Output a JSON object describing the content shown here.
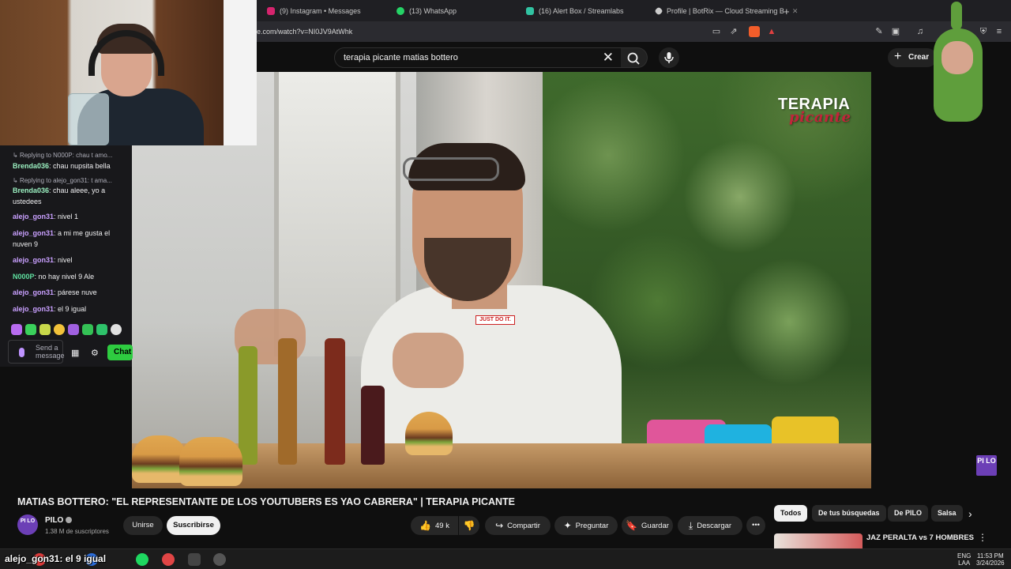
{
  "browser": {
    "tabs": [
      {
        "label": "(9) Instagram • Messages",
        "color": "#d6246e"
      },
      {
        "label": "(13) WhatsApp",
        "color": "#25d366"
      },
      {
        "label": "(16) Alert Box / Streamlabs",
        "color": "#31c3a2"
      },
      {
        "label": "Profile | BotRix — Cloud Streaming B",
        "color": "#cccccc"
      }
    ],
    "url": "e.com/watch?v=NI0JV9AtWhk"
  },
  "youtube": {
    "search_query": "terapia picante matias bottero",
    "create_label": "Crear",
    "watermark_top": "TERAPIA",
    "watermark_bottom": "picante",
    "channel_logo_text": "PI LO"
  },
  "video": {
    "title": "MATIAS BOTTERO: \"EL REPRESENTANTE DE LOS YOUTUBERS ES YAO CABRERA\" | TERAPIA PICANTE",
    "channel_name": "PILO",
    "subscribers": "1.38 M de suscriptores",
    "join_label": "Unirse",
    "subscribe_label": "Suscribirse",
    "likes": "49 k",
    "share_label": "Compartir",
    "ask_label": "Preguntar",
    "save_label": "Guardar",
    "download_label": "Descargar",
    "shirt_text": "JUST DO IT."
  },
  "chips": [
    "Todos",
    "De tus búsquedas",
    "De PILO",
    "Salsa"
  ],
  "recommendation": {
    "title": "JAZ PERALTA vs 7 HOMBRES"
  },
  "chat": {
    "messages": [
      {
        "reply": "Replying to N000P: chau t amo...",
        "user": "Brenda036",
        "color": "#9bf0c1",
        "text": "chau nupsita bella"
      },
      {
        "reply": "Replying to alejo_gon31: t ama...",
        "user": "Brenda036",
        "color": "#9bf0c1",
        "text": "chau aleee, yo a ustedees"
      },
      {
        "user": "alejo_gon31",
        "color": "#c9a0ff",
        "text": "nivel 1"
      },
      {
        "user": "alejo_gon31",
        "color": "#c9a0ff",
        "text": "a mi me gusta el nuven 9"
      },
      {
        "user": "alejo_gon31",
        "color": "#c9a0ff",
        "text": "nivel"
      },
      {
        "user": "N000P",
        "color": "#5fe0a0",
        "text": "no hay nivel 9 Ale"
      },
      {
        "user": "alejo_gon31",
        "color": "#c9a0ff",
        "text": "párese nuve"
      },
      {
        "user": "alejo_gon31",
        "color": "#c9a0ff",
        "text": "el 9 igual"
      }
    ],
    "input_placeholder": "Send a message",
    "chat_button": "Chat"
  },
  "ticker": "alejo_gon31: el 9 igual",
  "taskbar": {
    "lang_top": "ENG",
    "lang_bottom": "LAA",
    "time": "11:53 PM",
    "date": "3/24/2026"
  }
}
